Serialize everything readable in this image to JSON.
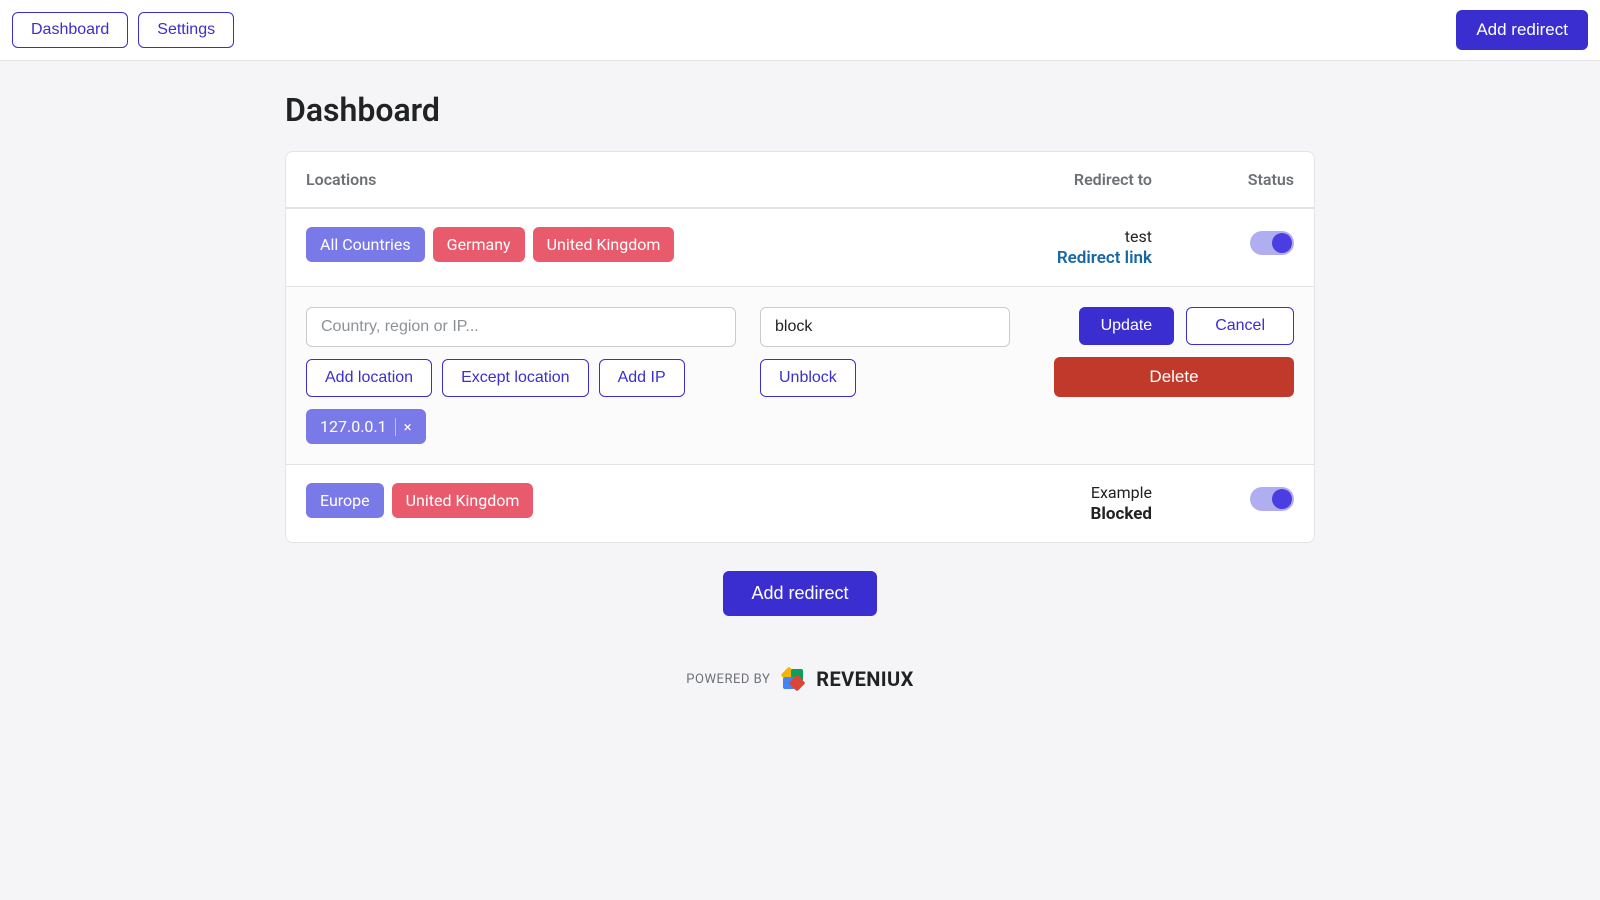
{
  "nav": {
    "dashboard": "Dashboard",
    "settings": "Settings",
    "add_redirect_top": "Add redirect"
  },
  "page": {
    "title": "Dashboard"
  },
  "columns": {
    "locations": "Locations",
    "redirect_to": "Redirect to",
    "status": "Status"
  },
  "rows": [
    {
      "tags": [
        {
          "label": "All Countries",
          "style": "primary"
        },
        {
          "label": "Germany",
          "style": "danger"
        },
        {
          "label": "United Kingdom",
          "style": "danger"
        }
      ],
      "redirect_title": "test",
      "redirect_sub": "Redirect link",
      "redirect_sub_style": "link",
      "status_on": true
    },
    {
      "tags": [
        {
          "label": "Europe",
          "style": "primary"
        },
        {
          "label": "United Kingdom",
          "style": "danger"
        }
      ],
      "redirect_title": "Example",
      "redirect_sub": "Blocked",
      "redirect_sub_style": "bold",
      "status_on": true
    }
  ],
  "editor": {
    "location_placeholder": "Country, region or IP...",
    "location_value": "",
    "add_location": "Add location",
    "except_location": "Except location",
    "add_ip": "Add IP",
    "chips": [
      {
        "label": "127.0.0.1",
        "removable": true
      }
    ],
    "action_value": "block",
    "unblock": "Unblock",
    "update": "Update",
    "cancel": "Cancel",
    "delete": "Delete"
  },
  "cta": {
    "add_redirect": "Add redirect"
  },
  "footer": {
    "powered_by": "POWERED BY",
    "brand": "REVENIUX"
  }
}
